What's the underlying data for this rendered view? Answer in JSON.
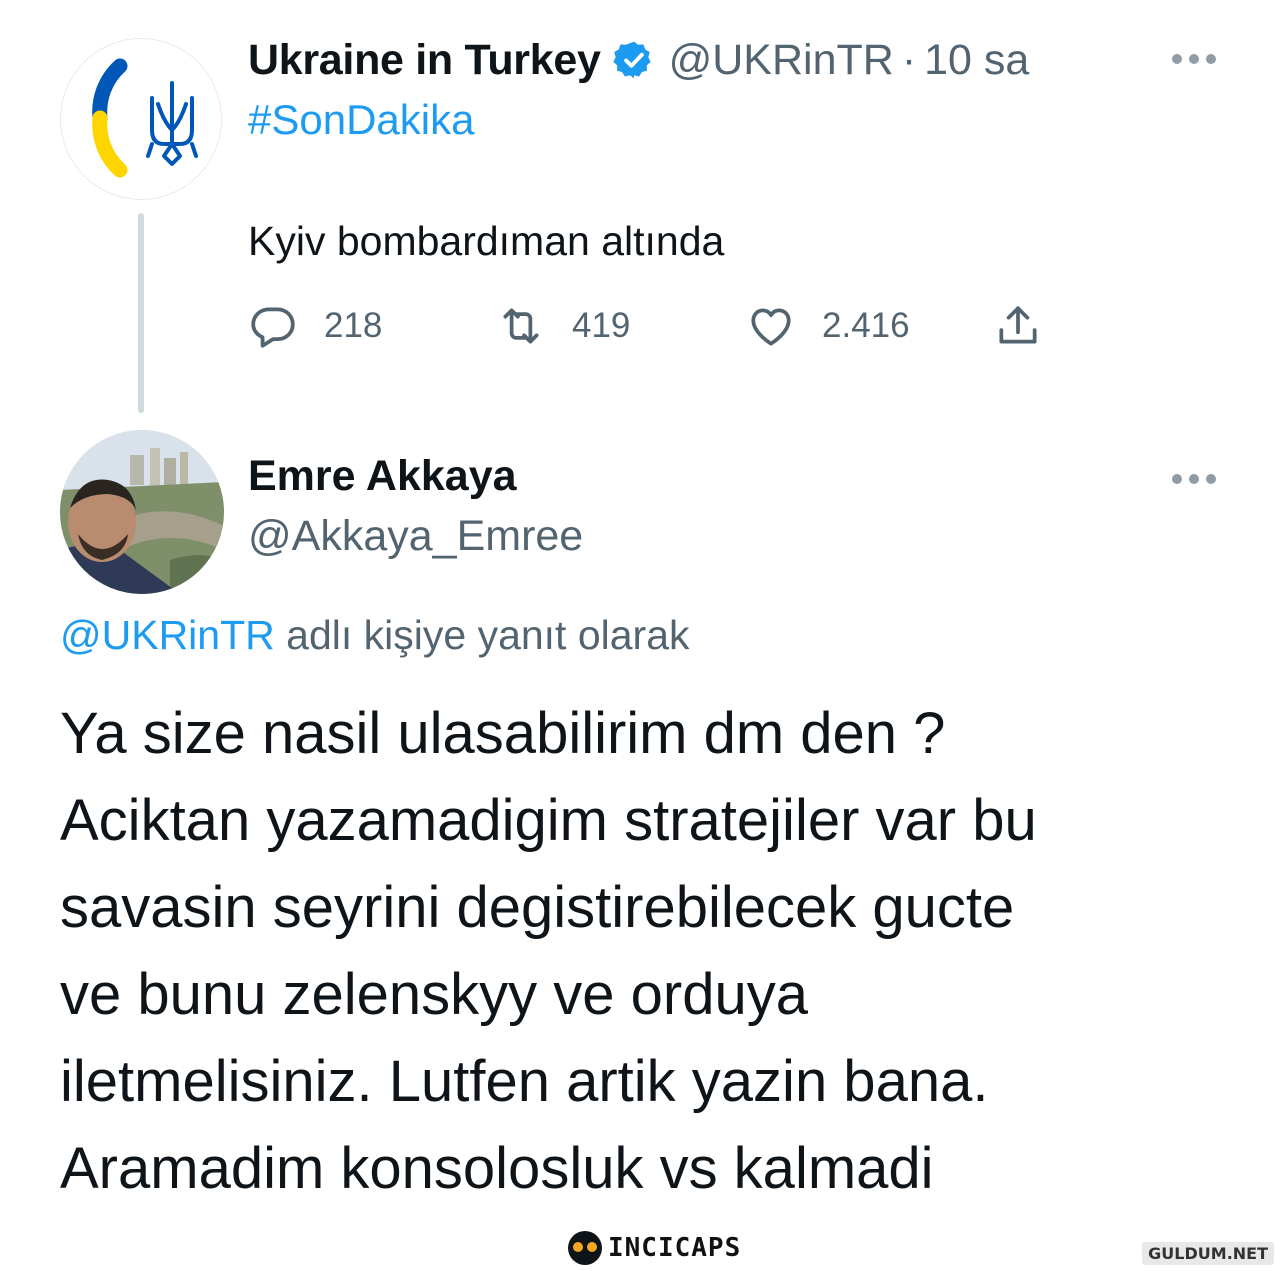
{
  "parent_tweet": {
    "display_name": "Ukraine in Turkey",
    "handle": "@UKRinTR",
    "separator": "·",
    "time": "10 sa",
    "hashtag": "#SonDakika",
    "text": "Kyiv bombardıman altında",
    "stats": {
      "replies": "218",
      "retweets": "419",
      "likes": "2.416"
    },
    "icons": [
      "verified-badge-icon",
      "reply-icon",
      "retweet-icon",
      "like-icon",
      "share-icon",
      "more-icon"
    ]
  },
  "reply_tweet": {
    "display_name": "Emre Akkaya",
    "handle": "@Akkaya_Emree",
    "replying_to_mention": "@UKRinTR",
    "replying_to_suffix": "adlı kişiye yanıt olarak",
    "body_lines": [
      "Ya size nasil ulasabilirim dm den ?",
      "Aciktan yazamadigim stratejiler var bu",
      "savasin seyrini degistirebilecek gucte",
      "ve bunu zelenskyy ve orduya",
      "iletmelisiniz. Lutfen artik yazin bana.",
      "Aramadim konsolosluk vs kalmadi"
    ]
  },
  "watermarks": {
    "center": "INCICAPS",
    "corner": "GULDUM.NET"
  },
  "colors": {
    "link_blue": "#1d9bf0",
    "secondary_text": "#536471",
    "primary_text": "#0f1419",
    "ukraine_blue": "#0057b7",
    "ukraine_yellow": "#ffd500"
  }
}
